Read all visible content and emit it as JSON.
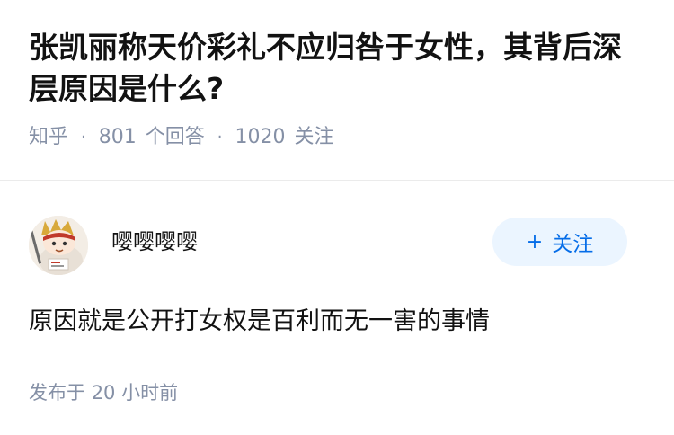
{
  "question": {
    "title": "张凯丽称天价彩礼不应归咎于女性，其背后深层原因是什么?",
    "source": "知乎",
    "answers_count": "801",
    "answers_label": "个回答",
    "followers_count": "1020",
    "followers_label": "关注"
  },
  "answer": {
    "author_name": "嘤嘤嘤嘤",
    "follow_label": "关注",
    "content": "原因就是公开打女权是百利而无一害的事情",
    "time_prefix": "发布于",
    "time_value": "20 小时前"
  },
  "colors": {
    "accent": "#056de8",
    "follow_bg": "#ebf5ff",
    "meta_gray": "#8590a6",
    "text_dark": "#121212"
  }
}
